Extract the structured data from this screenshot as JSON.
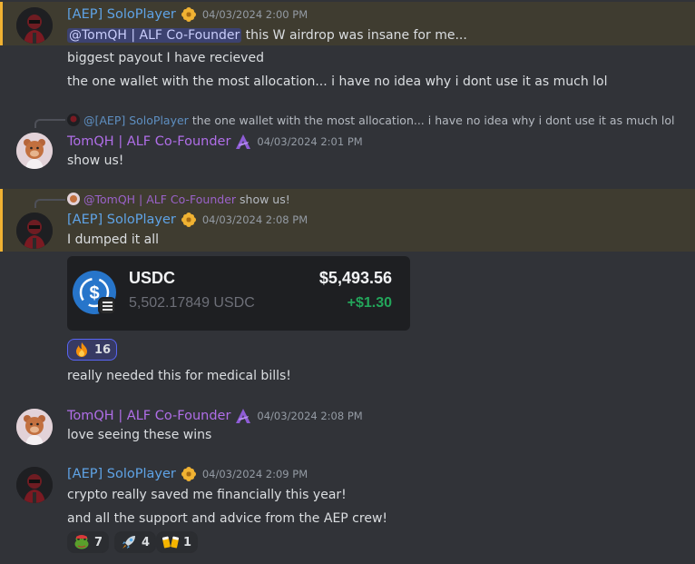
{
  "users": {
    "aep": {
      "name": "[AEP] SoloPlayer",
      "color": "#5fa3e6"
    },
    "tom": {
      "name": "TomQH | ALF Co-Founder",
      "color": "#b06ee8"
    }
  },
  "messages": [
    {
      "author": "[AEP] SoloPlayer",
      "time": "04/03/2024 2:00 PM",
      "highlighted": true,
      "mention": "@TomQH | ALF Co-Founder",
      "lines": [
        " this W airdrop was insane for me...",
        "biggest payout I have recieved",
        "the one wallet with the most allocation... i have no idea why i dont use it as much lol"
      ]
    },
    {
      "reply_to": {
        "name": "@[AEP] SoloPlayer",
        "text": "the one wallet with the most allocation... i have no idea why i dont use it as much lol"
      },
      "author": "TomQH | ALF Co-Founder",
      "time": "04/03/2024 2:01 PM",
      "lines": [
        "show us!"
      ]
    },
    {
      "highlighted": true,
      "reply_to": {
        "name": "@TomQH | ALF Co-Founder",
        "text": "show us!"
      },
      "author": "[AEP] SoloPlayer",
      "time": "04/03/2024 2:08 PM",
      "lines": [
        "I dumped it all",
        "really needed this for medical bills!"
      ],
      "card": {
        "symbol": "USDC",
        "amount": "5,502.17849 USDC",
        "usd_value": "$5,493.56",
        "change": "+$1.30"
      },
      "reactions": [
        {
          "emoji": "fire",
          "count": "16",
          "active": true
        }
      ]
    },
    {
      "author": "TomQH | ALF Co-Founder",
      "time": "04/03/2024 2:08 PM",
      "lines": [
        "love seeing these wins"
      ]
    },
    {
      "author": "[AEP] SoloPlayer",
      "time": "04/03/2024 2:09 PM",
      "lines": [
        "crypto really saved me financially this year!",
        "and all the support and advice from the AEP crew!"
      ],
      "reactions": [
        {
          "emoji": "frog",
          "count": "7"
        },
        {
          "emoji": "rocket",
          "count": "4"
        },
        {
          "emoji": "beer-cheers",
          "count": "1"
        }
      ]
    }
  ]
}
